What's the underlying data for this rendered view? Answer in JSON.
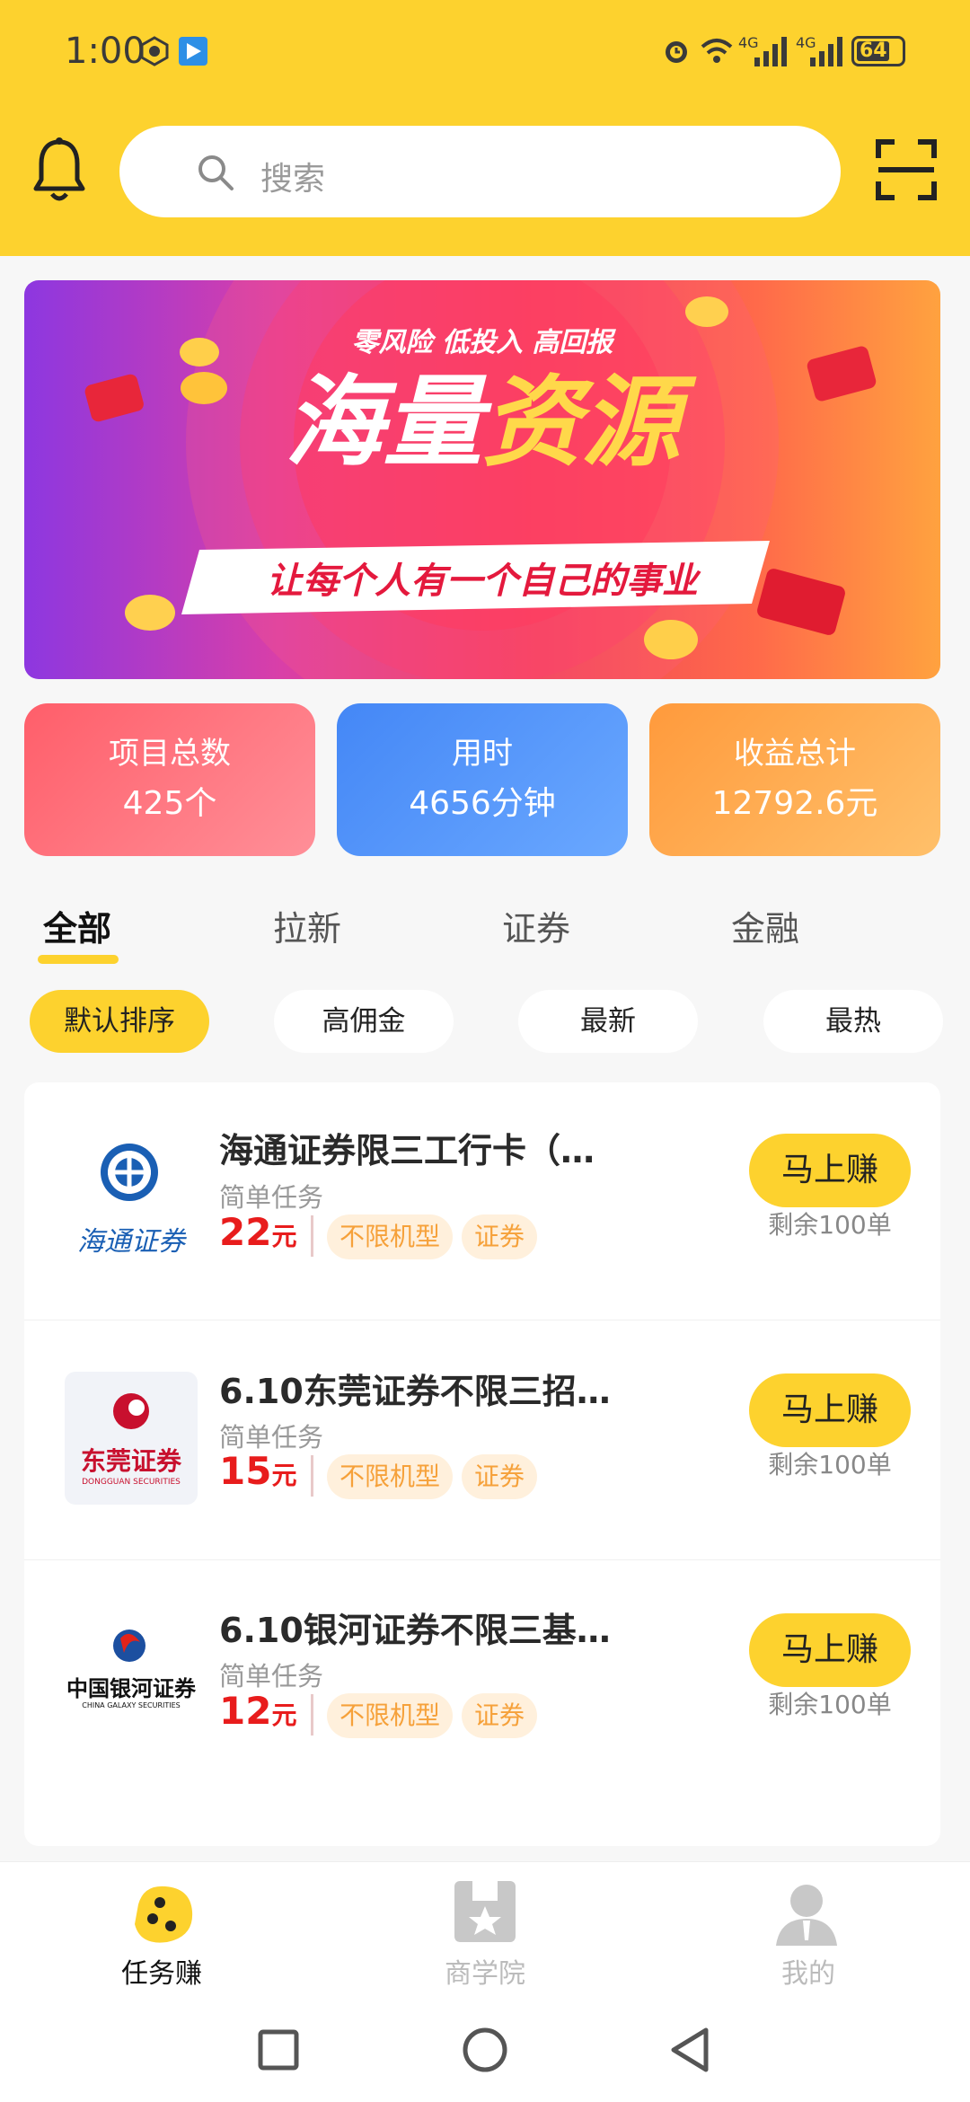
{
  "status": {
    "time": "1:00",
    "battery": "64",
    "net1": "4G",
    "net2": "4G"
  },
  "search": {
    "placeholder": "搜索"
  },
  "banner": {
    "slogan": "零风险  低投入  高回报",
    "title_a": "海量",
    "title_b": "资源",
    "ribbon": "让每个人有一个自己的事业"
  },
  "stats": [
    {
      "label": "项目总数",
      "value": "425个"
    },
    {
      "label": "用时",
      "value": "4656分钟"
    },
    {
      "label": "收益总计",
      "value": "12792.6元"
    }
  ],
  "tabs": [
    "全部",
    "拉新",
    "证券",
    "金融"
  ],
  "chips": [
    "默认排序",
    "高佣金",
    "最新",
    "最热"
  ],
  "items": [
    {
      "title": "海通证券限三工行卡（…",
      "sub": "简单任务",
      "price": "22",
      "unit": "元",
      "tags": [
        "不限机型",
        "证券"
      ],
      "btn": "马上赚",
      "remain": "剩余100单",
      "logo_text": "海通证券"
    },
    {
      "title": "6.10东莞证券不限三招…",
      "sub": "简单任务",
      "price": "15",
      "unit": "元",
      "tags": [
        "不限机型",
        "证券"
      ],
      "btn": "马上赚",
      "remain": "剩余100单",
      "logo_text": "东莞证券",
      "logo_sub": "DONGGUAN SECURITIES"
    },
    {
      "title": "6.10银河证券不限三基…",
      "sub": "简单任务",
      "price": "12",
      "unit": "元",
      "tags": [
        "不限机型",
        "证券"
      ],
      "btn": "马上赚",
      "remain": "剩余100单",
      "logo_text": "中国银河证券",
      "logo_sub": "CHINA GALAXY SECURITIES"
    }
  ],
  "nav": [
    "任务赚",
    "商学院",
    "我的"
  ],
  "colors": {
    "brand": "#fdd22e",
    "price": "#e81c1c",
    "tag_text": "#f6a13a"
  }
}
